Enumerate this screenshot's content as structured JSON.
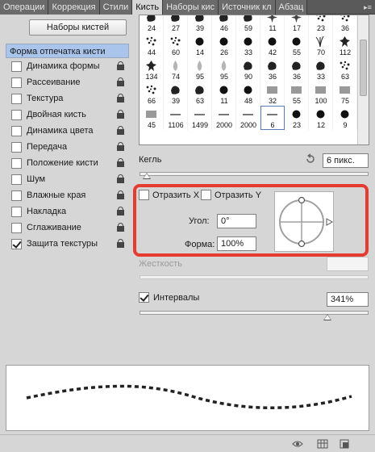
{
  "tabs": [
    {
      "label": "Операции",
      "active": false
    },
    {
      "label": "Коррекция",
      "active": false
    },
    {
      "label": "Стили",
      "active": false
    },
    {
      "label": "Кисть",
      "active": true
    },
    {
      "label": "Наборы кис",
      "active": false
    },
    {
      "label": "Источник кл",
      "active": false
    },
    {
      "label": "Абзац",
      "active": false
    }
  ],
  "presets_button": "Наборы кистей",
  "left_header": "Форма отпечатка кисти",
  "left_items": [
    {
      "label": "Динамика формы",
      "checked": false
    },
    {
      "label": "Рассеивание",
      "checked": false
    },
    {
      "label": "Текстура",
      "checked": false
    },
    {
      "label": "Двойная кисть",
      "checked": false
    },
    {
      "label": "Динамика цвета",
      "checked": false
    },
    {
      "label": "Передача",
      "checked": false
    },
    {
      "label": "Положение кисти",
      "checked": false
    },
    {
      "label": "Шум",
      "checked": false
    },
    {
      "label": "Влажные края",
      "checked": false
    },
    {
      "label": "Накладка",
      "checked": false
    },
    {
      "label": "Сглаживание",
      "checked": false
    },
    {
      "label": "Защита текстуры",
      "checked": true
    }
  ],
  "brush_grid": [
    {
      "size": "24"
    },
    {
      "size": "27"
    },
    {
      "size": "39"
    },
    {
      "size": "46"
    },
    {
      "size": "59"
    },
    {
      "size": "11"
    },
    {
      "size": "17"
    },
    {
      "size": "23"
    },
    {
      "size": "36"
    },
    {
      "size": "44"
    },
    {
      "size": "60"
    },
    {
      "size": "14"
    },
    {
      "size": "26"
    },
    {
      "size": "33"
    },
    {
      "size": "42"
    },
    {
      "size": "55"
    },
    {
      "size": "70"
    },
    {
      "size": "112"
    },
    {
      "size": "134"
    },
    {
      "size": "74"
    },
    {
      "size": "95"
    },
    {
      "size": "95"
    },
    {
      "size": "90"
    },
    {
      "size": "36"
    },
    {
      "size": "36"
    },
    {
      "size": "33"
    },
    {
      "size": "63"
    },
    {
      "size": "66"
    },
    {
      "size": "39"
    },
    {
      "size": "63"
    },
    {
      "size": "11"
    },
    {
      "size": "48"
    },
    {
      "size": "32"
    },
    {
      "size": "55"
    },
    {
      "size": "100"
    },
    {
      "size": "75"
    },
    {
      "size": "45"
    },
    {
      "size": "1106"
    },
    {
      "size": "1499"
    },
    {
      "size": "2000"
    },
    {
      "size": "2000"
    },
    {
      "size": "6"
    },
    {
      "size": "23"
    },
    {
      "size": "12"
    },
    {
      "size": "9"
    }
  ],
  "size": {
    "label": "Кегль",
    "value": "6 пикс.",
    "fraction": 0.03
  },
  "flip_x": {
    "label": "Отразить X",
    "checked": false
  },
  "flip_y": {
    "label": "Отразить Y",
    "checked": false
  },
  "angle": {
    "label": "Угол:",
    "value": "0°"
  },
  "roundness": {
    "label": "Форма:",
    "value": "100%"
  },
  "hardness": {
    "label": "Жесткость",
    "value": ""
  },
  "spacing": {
    "label": "Интервалы",
    "checked": true,
    "value": "341%",
    "fraction": 0.82
  },
  "colors": {
    "highlight": "#e53b30",
    "header": "#a9c5ec"
  }
}
